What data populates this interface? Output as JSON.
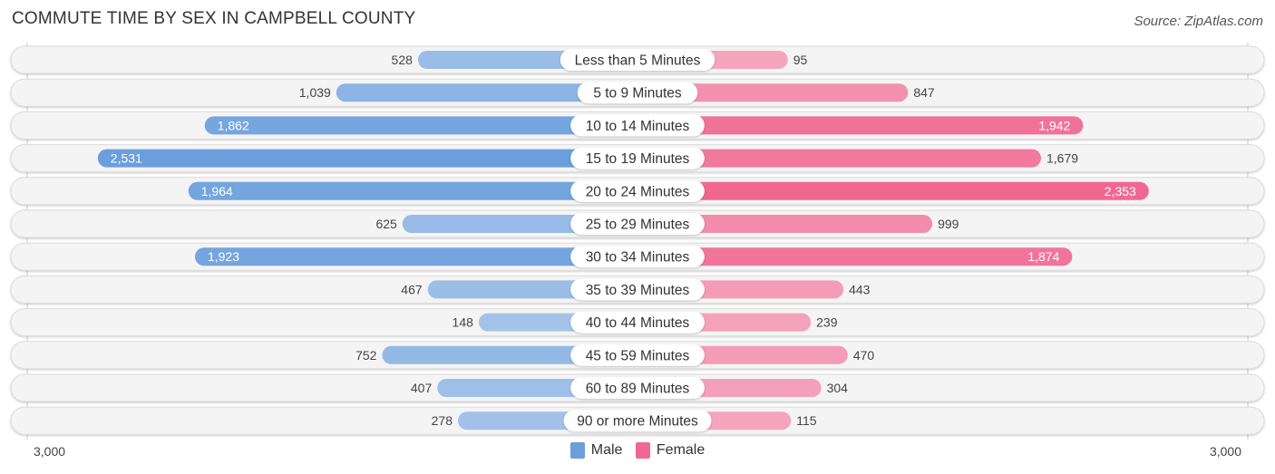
{
  "chart_data": {
    "type": "bar",
    "orientation": "horizontal-diverging",
    "title": "COMMUTE TIME BY SEX IN CAMPBELL COUNTY",
    "source": "Source: ZipAtlas.com",
    "categories": [
      "Less than 5 Minutes",
      "5 to 9 Minutes",
      "10 to 14 Minutes",
      "15 to 19 Minutes",
      "20 to 24 Minutes",
      "25 to 29 Minutes",
      "30 to 34 Minutes",
      "35 to 39 Minutes",
      "40 to 44 Minutes",
      "45 to 59 Minutes",
      "60 to 89 Minutes",
      "90 or more Minutes"
    ],
    "series": [
      {
        "name": "Male",
        "side": "left",
        "color": "#6a9fdc",
        "light_color": "#a8c6ea",
        "values": [
          528,
          1039,
          1862,
          2531,
          1964,
          625,
          1923,
          467,
          148,
          752,
          407,
          278
        ],
        "labels": [
          "528",
          "1,039",
          "1,862",
          "2,531",
          "1,964",
          "625",
          "1,923",
          "467",
          "148",
          "752",
          "407",
          "278"
        ]
      },
      {
        "name": "Female",
        "side": "right",
        "color": "#f06892",
        "light_color": "#f5a8c0",
        "values": [
          95,
          847,
          1942,
          1679,
          2353,
          999,
          1874,
          443,
          239,
          470,
          304,
          115
        ],
        "labels": [
          "95",
          "847",
          "1,942",
          "1,679",
          "2,353",
          "999",
          "1,874",
          "443",
          "239",
          "470",
          "304",
          "115"
        ]
      }
    ],
    "axis": {
      "left_label": "3,000",
      "right_label": "3,000",
      "max": 3000
    },
    "legend": {
      "position": "bottom-center",
      "entries": [
        "Male",
        "Female"
      ]
    },
    "grid": false
  }
}
